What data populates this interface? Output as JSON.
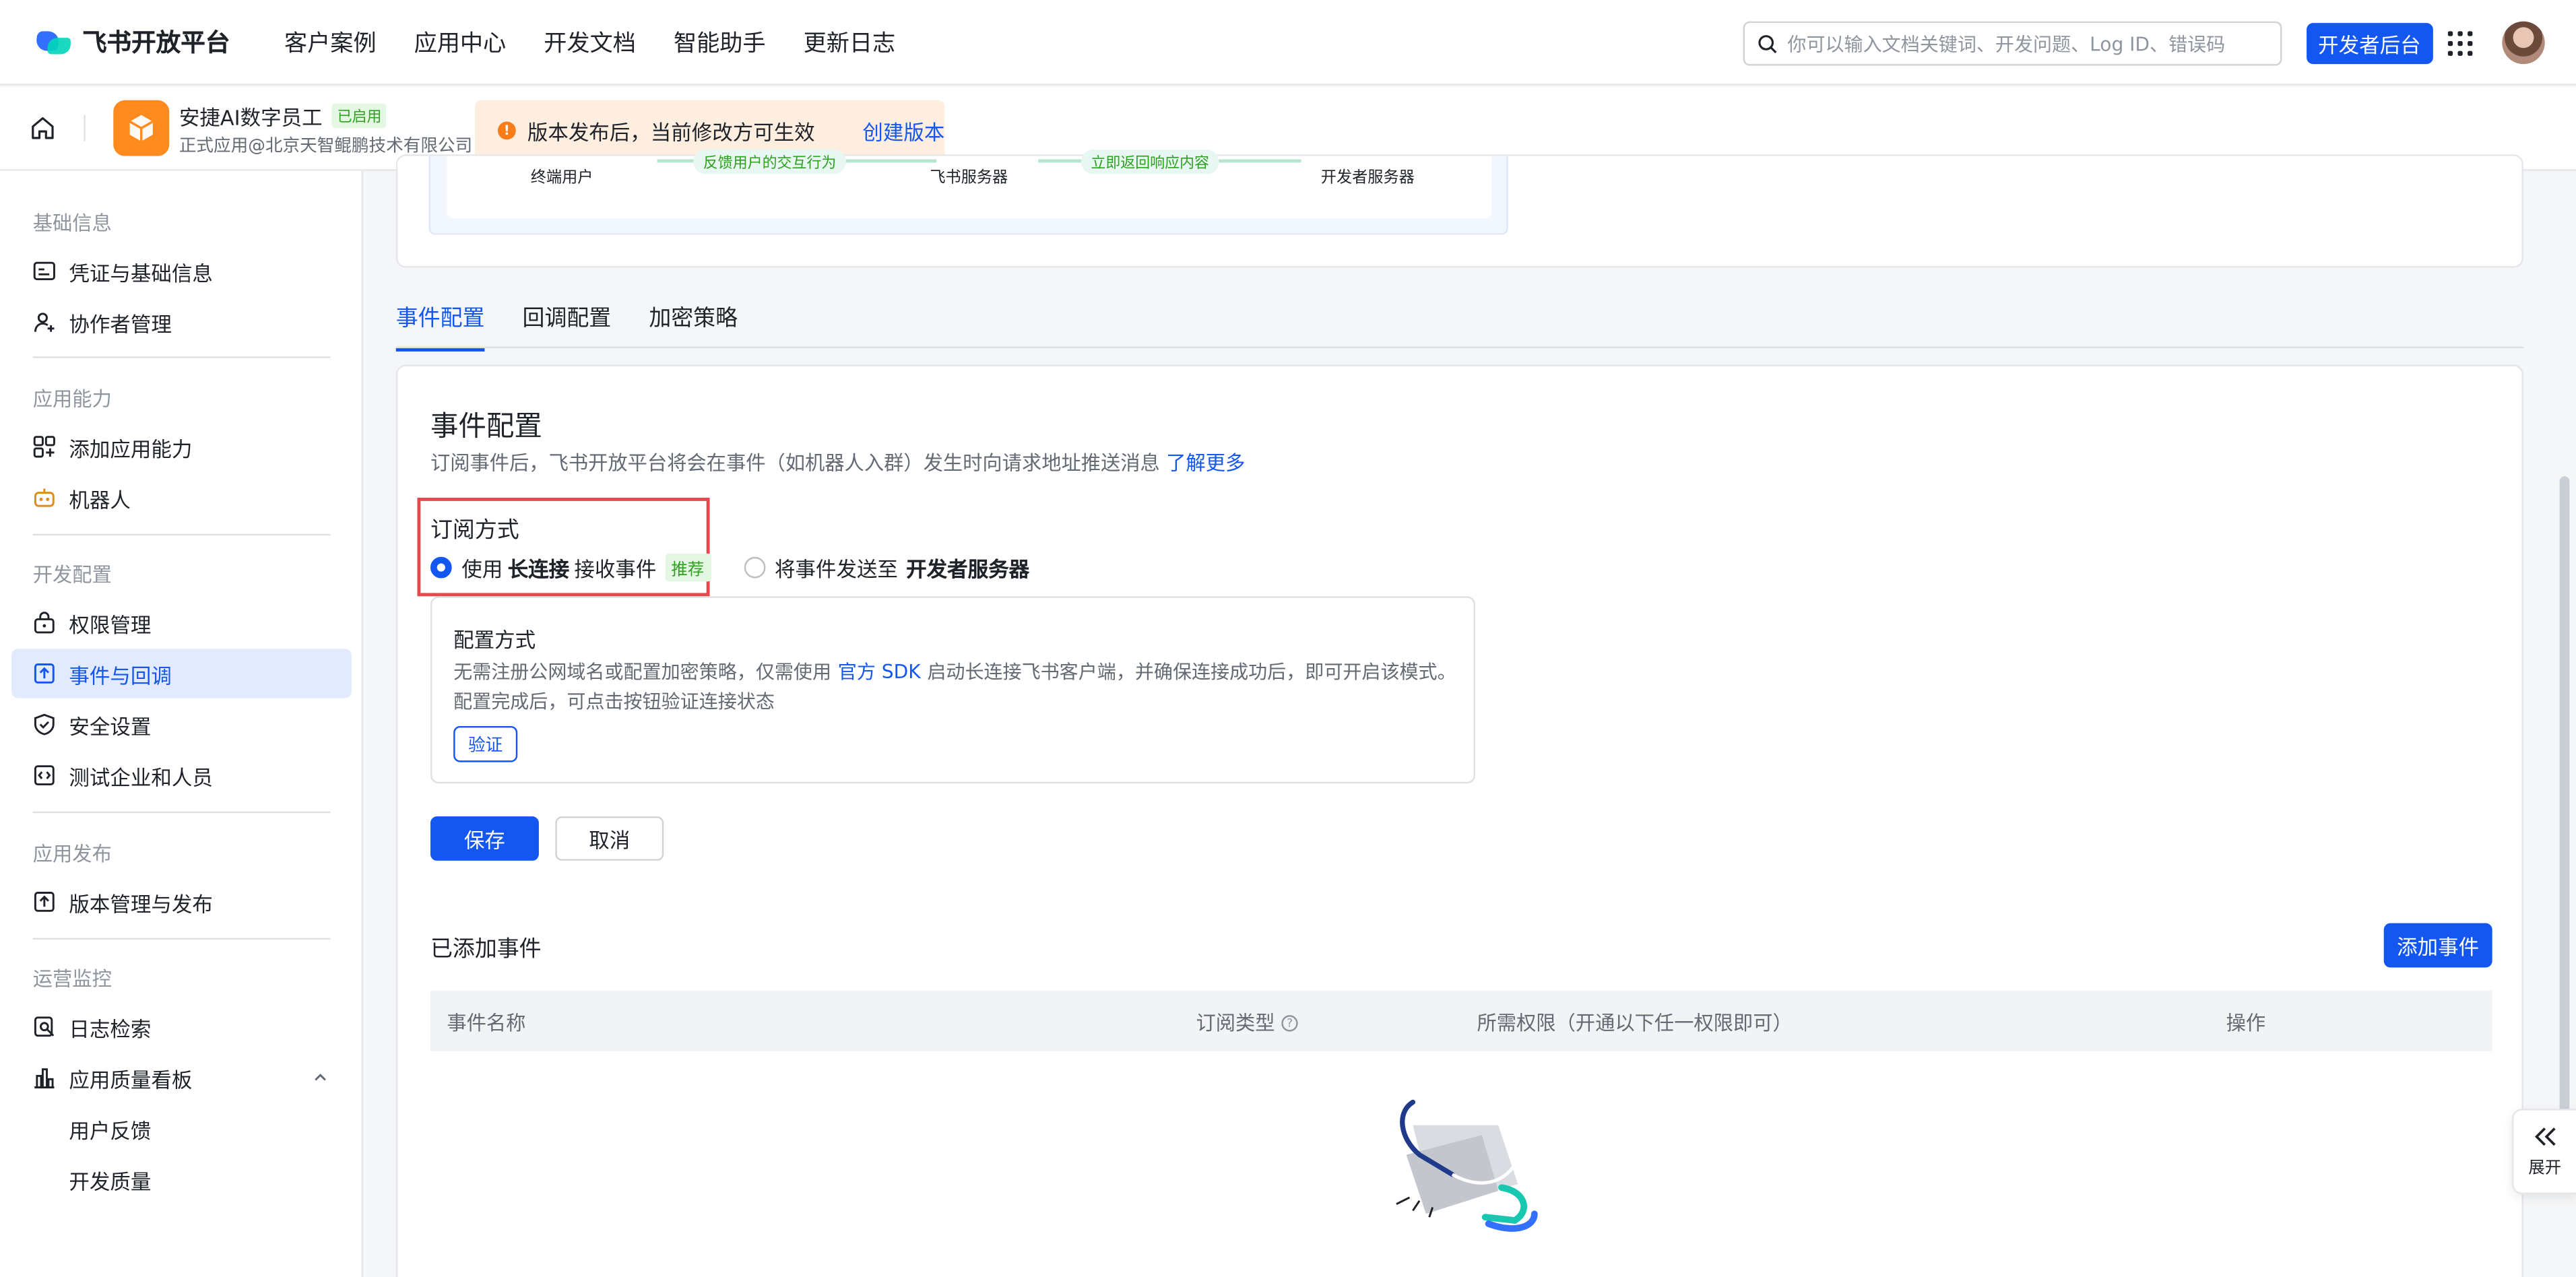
{
  "topnav": {
    "logo_text": "飞书开放平台",
    "links": [
      "客户案例",
      "应用中心",
      "开发文档",
      "智能助手",
      "更新日志"
    ],
    "search_placeholder": "你可以输入文档关键词、开发问题、Log ID、错误码",
    "dev_console_label": "开发者后台"
  },
  "appbar": {
    "app_name": "安捷AI数字员工",
    "status_badge": "已启用",
    "app_sub": "正式应用@北京天智鲲鹏技术有限公司",
    "notice_text": "版本发布后，当前修改方可生效",
    "notice_link": "创建版本"
  },
  "sidebar": {
    "groups": [
      {
        "title": "基础信息",
        "items": [
          "凭证与基础信息",
          "协作者管理"
        ]
      },
      {
        "title": "应用能力",
        "items": [
          "添加应用能力",
          "机器人"
        ]
      },
      {
        "title": "开发配置",
        "items": [
          "权限管理",
          "事件与回调",
          "安全设置",
          "测试企业和人员"
        ]
      },
      {
        "title": "应用发布",
        "items": [
          "版本管理与发布"
        ]
      },
      {
        "title": "运营监控",
        "items": [
          "日志检索",
          "应用质量看板",
          "用户反馈",
          "开发质量"
        ]
      }
    ],
    "active_item": "事件与回调"
  },
  "flow": {
    "labels": [
      "终端用户",
      "飞书服务器",
      "开发者服务器"
    ],
    "tags": [
      "反馈用户的交互行为",
      "立即返回响应内容"
    ]
  },
  "tabs": [
    "事件配置",
    "回调配置",
    "加密策略"
  ],
  "event_config": {
    "title": "事件配置",
    "desc": "订阅事件后，飞书开放平台将会在事件（如机器人入群）发生时向请求地址推送消息",
    "desc_link": "了解更多",
    "subscribe_title": "订阅方式",
    "option1_pre": "使用",
    "option1_bold": "长连接",
    "option1_post": "接收事件",
    "option1_tag": "推荐",
    "option2_pre": "将事件发送至",
    "option2_bold": "开发者服务器",
    "config_title": "配置方式",
    "config_text_1": "无需注册公网域名或配置加密策略，仅需使用",
    "config_link": "官方 SDK",
    "config_text_2": "启动长连接飞书客户端，并确保连接成功后，即可开启该模式。",
    "config_text_3": "配置完成后，可点击按钮验证连接状态",
    "verify_label": "验证",
    "save_label": "保存",
    "cancel_label": "取消",
    "added_title": "已添加事件",
    "add_event_label": "添加事件",
    "columns": [
      "事件名称",
      "订阅类型",
      "所需权限（开通以下任一权限即可）",
      "操作"
    ]
  },
  "expand_label": "展开",
  "colors": {
    "accent": "#1456f0",
    "highlight": "#e5484d",
    "success": "#2ea121",
    "warning": "#f77d1a"
  }
}
